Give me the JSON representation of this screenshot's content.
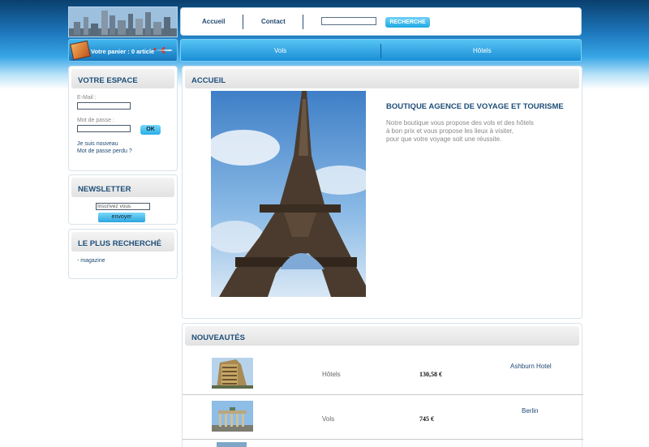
{
  "header": {
    "nav": [
      "Accueil",
      "Contact"
    ],
    "search": {
      "value": "",
      "button_label": "RECHERCHE"
    },
    "cart_text": "Votre panier : 0 article",
    "bar_links": [
      "Vols",
      "Hôtels"
    ]
  },
  "sidebar": {
    "espace": {
      "title": "VOTRE ESPACE",
      "email_label": "E-Mail :",
      "password_label": "Mot de passe :",
      "ok_label": "OK",
      "new_link": "Je suis nouveau",
      "lost_link": "Mot de passe perdu ?"
    },
    "newsletter": {
      "title": "NEWSLETTER",
      "input_value": "Inscrivez vous",
      "button_label": "envoyer"
    },
    "popular": {
      "title": "LE PLUS RECHERCHÉ",
      "items": [
        "- magazine"
      ]
    }
  },
  "main": {
    "accueil": {
      "title": "ACCUEIL",
      "heading": "BOUTIQUE AGENCE DE VOYAGE ET TOURISME",
      "lines": [
        "Notre boutique vous propose des vols et des hôtels",
        "à bon prix et vous propose les lieux à visiter,",
        "pour que votre voyage soit une réussite."
      ]
    },
    "nouveautes": {
      "title": "NOUVEAUTÉS",
      "rows": [
        {
          "category": "Hôtels",
          "price": "130,58 €",
          "name": "Ashburn Hotel"
        },
        {
          "category": "Vols",
          "price": "745 €",
          "name": "Berlin"
        }
      ]
    }
  },
  "colors": {
    "accent": "#1d4e78",
    "bar": "#1a8ed6",
    "button": "#28ace6"
  }
}
